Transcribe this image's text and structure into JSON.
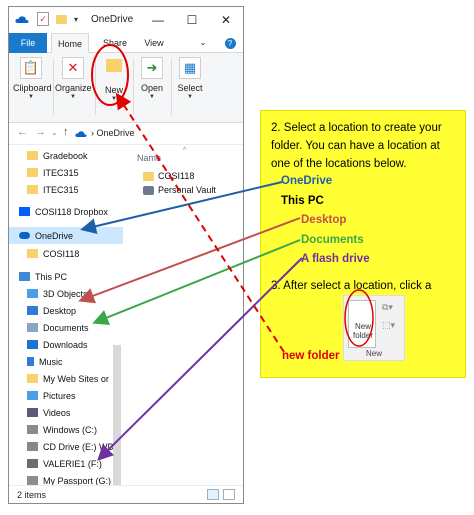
{
  "window": {
    "title": "OneDrive",
    "tabs": [
      "File",
      "Home",
      "Share",
      "View"
    ],
    "ribbon": {
      "clipboard": "Clipboard",
      "organize": "Organize",
      "new": "New",
      "open": "Open",
      "select": "Select"
    },
    "address": {
      "crumb": "OneDrive"
    },
    "nav_items": [
      "Gradebook",
      "ITEC315",
      "ITEC315",
      "COSI118 Dropbox",
      "OneDrive",
      "COSI118",
      "This PC",
      "3D Objects",
      "Desktop",
      "Documents",
      "Downloads",
      "Music",
      "My Web Sites or",
      "Pictures",
      "Videos",
      "Windows (C:)",
      "CD Drive (E:) WD",
      "VALERIE1 (F:)",
      "My Passport (G:)"
    ],
    "content": {
      "header": "Name",
      "items": [
        "COSI118",
        "Personal Vault"
      ]
    },
    "status": "2 items"
  },
  "panel": {
    "step2": "2. Select a location to create your folder.  You can have a location at one of the locations below.",
    "locations": {
      "onedrive": "OneDrive",
      "thispc": "This PC",
      "desktop": "Desktop",
      "documents": "Documents",
      "flash": "A flash drive"
    },
    "step3": "3. After select a location, click a",
    "new_button": {
      "label": "New folder",
      "group": "New"
    }
  },
  "new_folder_label": "new folder",
  "colors": {
    "onedrive": "#1f5fa8",
    "desktop": "#c0504d",
    "documents": "#3aa84a",
    "flash": "#7030a0",
    "new_folder": "#e00000",
    "panel": "#ffff33"
  }
}
